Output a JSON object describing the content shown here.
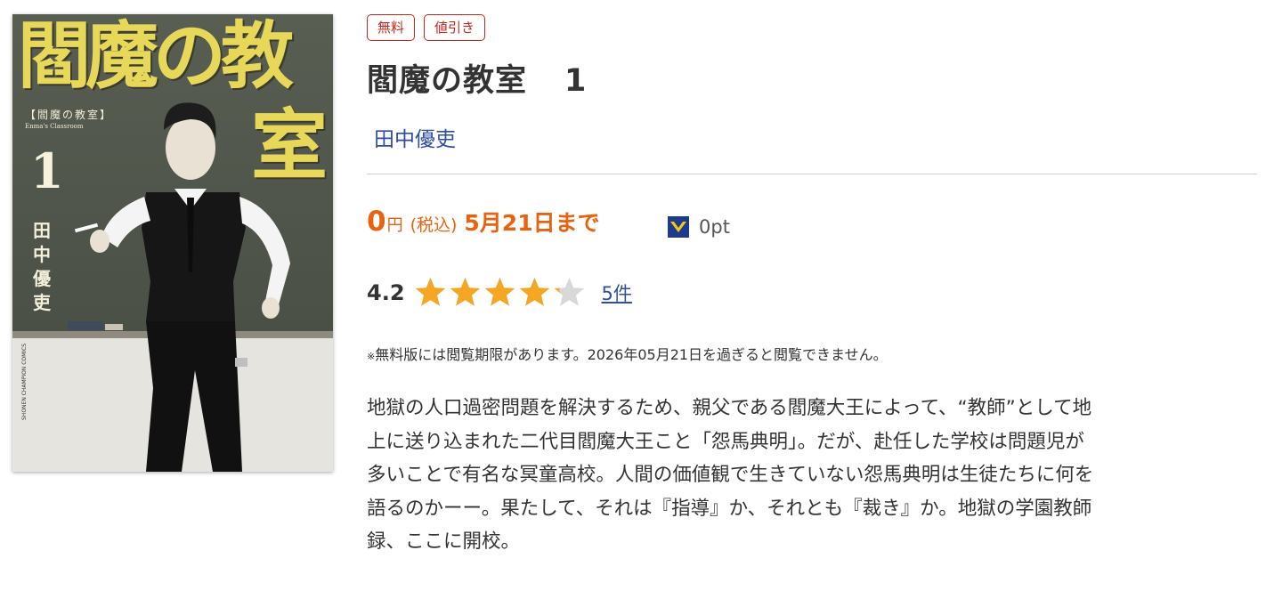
{
  "cover": {
    "title_line1": "閻魔の教",
    "title_line2": "室",
    "subtitle": "【閻魔の教室】",
    "subtitle_small": "Enma's Classroom",
    "volume": "1",
    "author": "田中優吏",
    "brand": "SHONEN CHAMPION COMICS"
  },
  "badges": [
    "無料",
    "値引き"
  ],
  "title": {
    "name": "閻魔の教室",
    "volume": "1"
  },
  "author": "田中優吏",
  "price": {
    "value": "0",
    "yen": "円",
    "tax": "(税込)",
    "until": "5月21日まで",
    "points": "0pt"
  },
  "rating": {
    "value": "4.2",
    "score": 4.2,
    "count": "5件"
  },
  "notice": {
    "mark": "※",
    "text": "無料版には閲覧期限があります。2026年05月21日を過ぎると閲覧できません。"
  },
  "description": "地獄の人口過密問題を解決するため、親父である閻魔大王によって、“教師”として地\n上に送り込まれた二代目閻魔大王こと「怨馬典明」。だが、赴任した学校は問題児が\n多いことで有名な冥童高校。人間の価値観で生きていない怨馬典明は生徒たちに何を\n語るのかーー。果たして、それは『指導』か、それとも『裁き』か。地獄の学園教師\n録、ここに開校。",
  "colors": {
    "accent": "#e8620f",
    "badge": "#c4281c",
    "link": "#2c4ea3",
    "star": "#f5a623",
    "star_empty": "#d8d8d8",
    "cover_title": "#e7d85a"
  }
}
